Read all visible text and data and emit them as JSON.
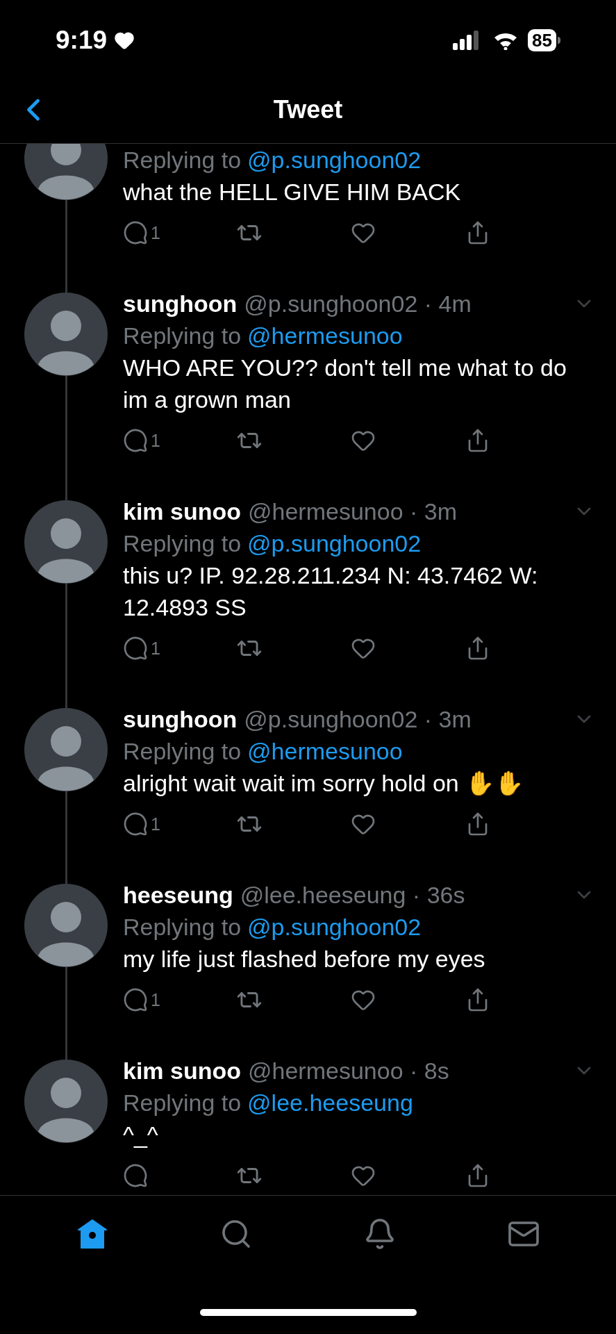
{
  "status_bar": {
    "time": "9:19",
    "battery": "85"
  },
  "header": {
    "title": "Tweet"
  },
  "tweets": [
    {
      "replying_label": "Replying to",
      "replying_to": "@p.sunghoon02",
      "body": "what the HELL GIVE HIM BACK",
      "reply_count": "1",
      "connected_below": true
    },
    {
      "name": "sunghoon",
      "handle": "@p.sunghoon02 · 4m",
      "replying_label": "Replying to",
      "replying_to": "@hermesunoo",
      "body": "WHO ARE YOU?? don't tell me what to do im a grown man",
      "reply_count": "1",
      "connected_above": true,
      "connected_below": true
    },
    {
      "name": "kim sunoo",
      "handle": "@hermesunoo · 3m",
      "replying_label": "Replying to",
      "replying_to": "@p.sunghoon02",
      "body": "this u? IP. 92.28.211.234 N: 43.7462 W: 12.4893 SS",
      "reply_count": "1",
      "connected_above": true,
      "connected_below": true
    },
    {
      "name": "sunghoon",
      "handle": "@p.sunghoon02 · 3m",
      "replying_label": "Replying to",
      "replying_to": "@hermesunoo",
      "body": "alright wait wait im sorry hold on ✋✋",
      "reply_count": "1",
      "connected_above": true,
      "connected_below": true
    },
    {
      "name": "heeseung",
      "handle": "@lee.heeseung · 36s",
      "replying_label": "Replying to",
      "replying_to": "@p.sunghoon02",
      "body": "my life just flashed before my eyes",
      "reply_count": "1",
      "connected_above": true,
      "connected_below": true
    },
    {
      "name": "kim sunoo",
      "handle": "@hermesunoo · 8s",
      "replying_label": "Replying to",
      "replying_to": "@lee.heeseung",
      "body": "^_^",
      "connected_above": true,
      "connected_below": false
    }
  ],
  "tab_bar": [
    {
      "kind": "home",
      "selected": true
    },
    {
      "kind": "search",
      "selected": false
    },
    {
      "kind": "notifications",
      "selected": false
    },
    {
      "kind": "messages",
      "selected": false
    }
  ]
}
